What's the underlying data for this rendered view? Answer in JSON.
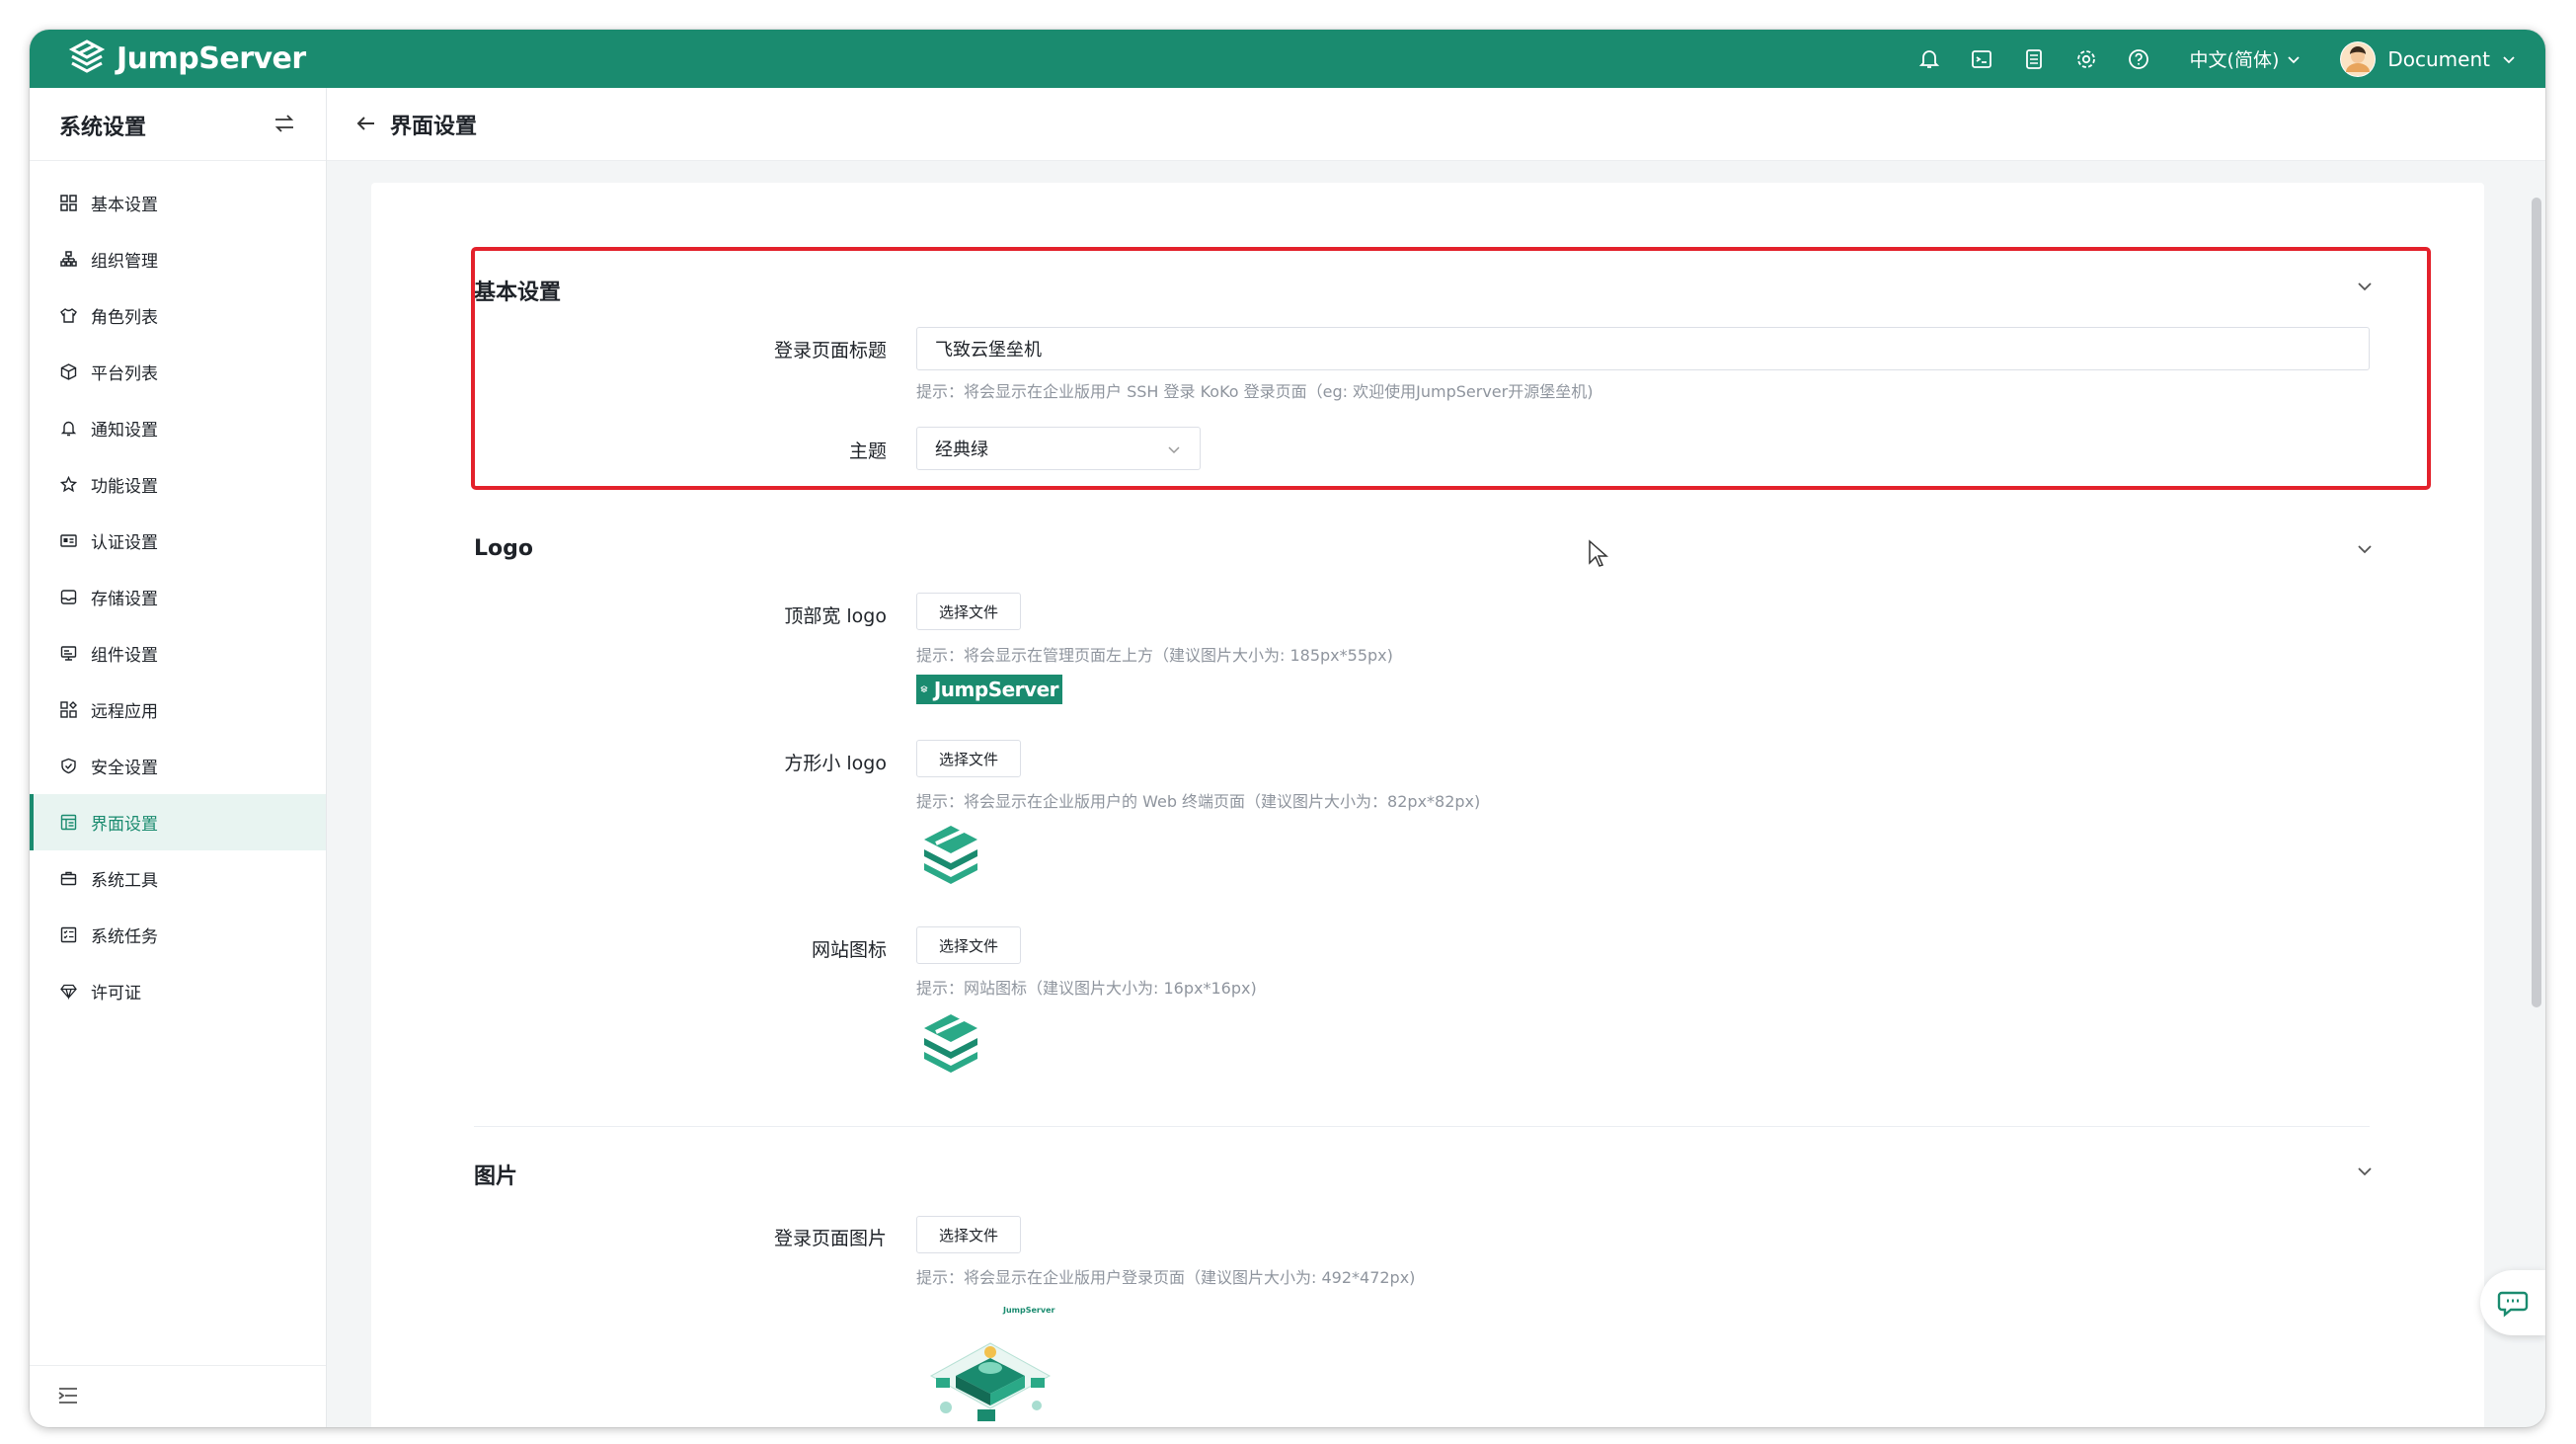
{
  "app": {
    "brand": "JumpServer"
  },
  "topbar": {
    "icons": [
      "bell-icon",
      "terminal-icon",
      "document-icon",
      "gear-icon",
      "help-icon"
    ],
    "language": "中文(简体)",
    "user": "Document"
  },
  "sidebar": {
    "title": "系统设置",
    "items": [
      {
        "label": "基本设置",
        "icon": "grid-icon",
        "active": false
      },
      {
        "label": "组织管理",
        "icon": "org-icon",
        "active": false
      },
      {
        "label": "角色列表",
        "icon": "shirt-icon",
        "active": false
      },
      {
        "label": "平台列表",
        "icon": "cube-icon",
        "active": false
      },
      {
        "label": "通知设置",
        "icon": "bell-icon",
        "active": false
      },
      {
        "label": "功能设置",
        "icon": "star-icon",
        "active": false
      },
      {
        "label": "认证设置",
        "icon": "id-card-icon",
        "active": false
      },
      {
        "label": "存储设置",
        "icon": "inbox-icon",
        "active": false
      },
      {
        "label": "组件设置",
        "icon": "monitor-icon",
        "active": false
      },
      {
        "label": "远程应用",
        "icon": "apps-icon",
        "active": false
      },
      {
        "label": "安全设置",
        "icon": "shield-icon",
        "active": false
      },
      {
        "label": "界面设置",
        "icon": "layout-icon",
        "active": true
      },
      {
        "label": "系统工具",
        "icon": "toolbox-icon",
        "active": false
      },
      {
        "label": "系统任务",
        "icon": "task-list-icon",
        "active": false
      },
      {
        "label": "许可证",
        "icon": "diamond-icon",
        "active": false
      }
    ]
  },
  "page": {
    "title": "界面设置"
  },
  "basic": {
    "title": "基本设置",
    "login_title_label": "登录页面标题",
    "login_title_value": "飞致云堡垒机",
    "login_title_hint": "提示：将会显示在企业版用户 SSH 登录 KoKo 登录页面（eg: 欢迎使用JumpServer开源堡垒机)",
    "theme_label": "主题",
    "theme_value": "经典绿"
  },
  "logo": {
    "title": "Logo",
    "top_logo_label": "顶部宽 logo",
    "top_logo_hint": "提示：将会显示在管理页面左上方（建议图片大小为: 185px*55px)",
    "square_logo_label": "方形小 logo",
    "square_logo_hint": "提示：将会显示在企业版用户的 Web 终端页面（建议图片大小为：82px*82px)",
    "favicon_label": "网站图标",
    "favicon_hint": "提示：网站图标（建议图片大小为: 16px*16px)",
    "choose_file": "选择文件",
    "banner_text": "JumpServer"
  },
  "images": {
    "title": "图片",
    "login_image_label": "登录页面图片",
    "login_image_hint": "提示：将会显示在企业版用户登录页面（建议图片大小为: 492*472px)",
    "choose_file": "选择文件",
    "mini_brand": "JumpServer"
  },
  "colors": {
    "primary": "#1a8b6f",
    "highlight": "#e3212b",
    "active_bg": "#e8f4f1"
  }
}
